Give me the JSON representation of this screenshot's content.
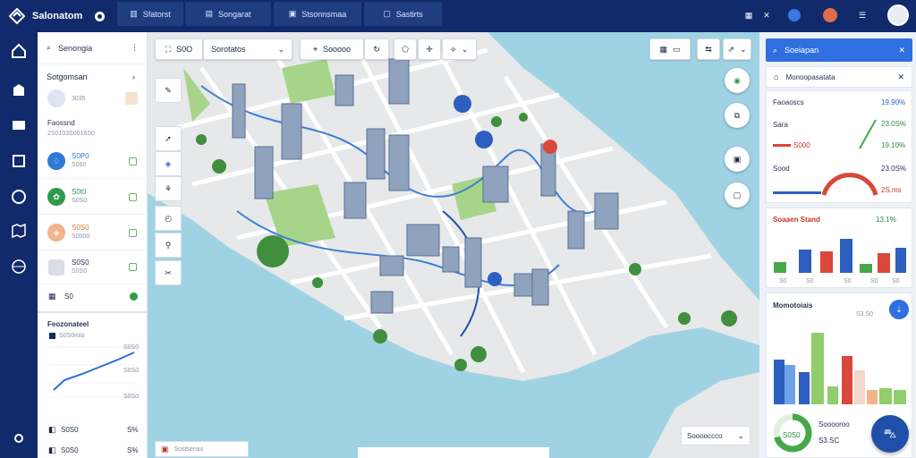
{
  "topbar": {
    "brand": "Salonatom",
    "tabs": [
      "Sfatorst",
      "Songarat",
      "Stsonnsmaa",
      "Sastirts"
    ]
  },
  "left_panel": {
    "search_label": "Senongia",
    "section1_title": "Sotgomsan",
    "item1_value": "3035",
    "group_label": "Faossnd",
    "group_sub": "2S0103S0016S0",
    "items": [
      {
        "title": "S0P0",
        "value": "S060"
      },
      {
        "title": "S0t0",
        "value": "S0S0"
      },
      {
        "title": "S0S0",
        "value": "S0000"
      },
      {
        "title": "S0S0",
        "value": "S0S0"
      }
    ],
    "footer_item": "S0",
    "chart_title": "Feozonateel",
    "chart_legend": "S0S0mio",
    "chart_labels": [
      "S0S0",
      "S0S0",
      "S0S0"
    ],
    "bottom_rows": [
      {
        "label": "S0S0",
        "value": "S%"
      },
      {
        "label": "S0S0",
        "value": "S%"
      }
    ]
  },
  "map": {
    "toolbar": {
      "dropdown1": "S0O",
      "dropdown2": "Sorotatos",
      "field3": "Sooooo"
    },
    "bottom_left_label": "Sostsenas",
    "bottom_right_select": "Sooooccco"
  },
  "right_panel": {
    "search_label": "Soeiapan",
    "subheader": "Monoopasatata",
    "stats_title": "Faoaoscs",
    "stats_values": [
      "19.90%",
      "23.0S%",
      "19.10%",
      "23.0S%",
      "2S.ms"
    ],
    "stats_mid_label": "S000",
    "stats_label3": "Sood",
    "bar_card_title": "Soaaen Stand",
    "bar_card_value": "13.1%",
    "bar_chart_labels": [
      "S0",
      "S0",
      "S0",
      "S0",
      "S0"
    ],
    "bottom_card_title": "Momotoiais",
    "bottom_card_value": "S3.S0",
    "donut_value": "S0S0",
    "donut_title": "Sooooroo",
    "donut_sub": "S3.SC"
  },
  "colors": {
    "accent": "#1f5fd6",
    "nav_bg": "#102a6b",
    "green": "#46a848",
    "red": "#d9483b",
    "blue": "#2c5fbf"
  }
}
